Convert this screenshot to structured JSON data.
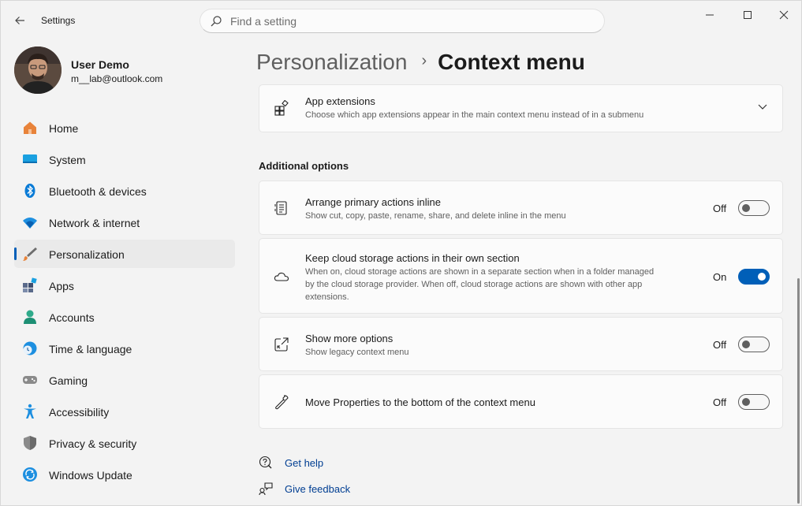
{
  "window": {
    "title": "Settings"
  },
  "search": {
    "placeholder": "Find a setting"
  },
  "profile": {
    "name": "User Demo",
    "email": "m__lab@outlook.com"
  },
  "nav": {
    "items": [
      {
        "label": "Home",
        "icon": "home-icon"
      },
      {
        "label": "System",
        "icon": "system-icon"
      },
      {
        "label": "Bluetooth & devices",
        "icon": "bluetooth-icon"
      },
      {
        "label": "Network & internet",
        "icon": "network-icon"
      },
      {
        "label": "Personalization",
        "icon": "personalization-icon",
        "active": true
      },
      {
        "label": "Apps",
        "icon": "apps-icon"
      },
      {
        "label": "Accounts",
        "icon": "accounts-icon"
      },
      {
        "label": "Time & language",
        "icon": "time-language-icon"
      },
      {
        "label": "Gaming",
        "icon": "gaming-icon"
      },
      {
        "label": "Accessibility",
        "icon": "accessibility-icon"
      },
      {
        "label": "Privacy & security",
        "icon": "privacy-shield-icon"
      },
      {
        "label": "Windows Update",
        "icon": "windows-update-icon"
      }
    ]
  },
  "breadcrumb": {
    "parent": "Personalization",
    "separator": "›",
    "current": "Context menu"
  },
  "app_extensions": {
    "title": "App extensions",
    "description": "Choose which app extensions appear in the main context menu instead of in a submenu"
  },
  "additional_options": {
    "heading": "Additional options",
    "items": [
      {
        "title": "Arrange primary actions inline",
        "description": "Show cut, copy, paste, rename, share, and delete inline in the menu",
        "state": "Off"
      },
      {
        "title": "Keep cloud storage actions in their own section",
        "description_lines": [
          "When on, cloud storage actions are shown in a separate section when in a folder managed",
          "by the cloud storage provider. When off, cloud storage actions are shown with other app",
          "extensions."
        ],
        "state": "On"
      },
      {
        "title": "Show more options",
        "description": "Show legacy context menu",
        "state": "Off"
      },
      {
        "title": "Move Properties to the bottom of the context menu",
        "state": "Off"
      }
    ]
  },
  "links": {
    "help": "Get help",
    "feedback": "Give feedback"
  },
  "colors": {
    "accent": "#005fb8",
    "link": "#003e92",
    "background": "#f3f3f3",
    "card": "#fbfbfb"
  }
}
